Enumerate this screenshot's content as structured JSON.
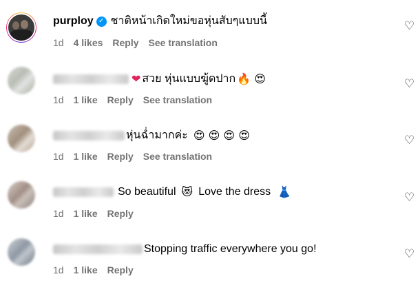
{
  "comments": [
    {
      "username": "purploy",
      "verified": true,
      "text": "ชาติหน้าเกิดใหม่ขอหุ่นสับๆแบบนี้",
      "time": "1d",
      "likes": "4 likes",
      "reply": "Reply",
      "translate": "See translation"
    },
    {
      "text": "สวย หุ่นแบบฆู้ดปาก",
      "emoji_before": "❤",
      "emoji_after": "🔥 😍",
      "time": "1d",
      "likes": "1 like",
      "reply": "Reply",
      "translate": "See translation"
    },
    {
      "text": "หุ่นฉ่ำมากค่ะ",
      "emoji_after": "😍 😍 😍 😍",
      "time": "1d",
      "likes": "1 like",
      "reply": "Reply",
      "translate": "See translation"
    },
    {
      "text": "So beautiful",
      "emoji_mid": "😻",
      "text2": "Love the dress",
      "emoji_after": "👗",
      "time": "1d",
      "likes": "1 like",
      "reply": "Reply"
    },
    {
      "text": "Stopping traffic everywhere you go!",
      "time": "1d",
      "likes": "1 like",
      "reply": "Reply"
    }
  ],
  "icons": {
    "like": "heart-outline-icon",
    "verified": "verified-badge-icon"
  },
  "colors": {
    "meta": "#737373",
    "verified": "#0095f6"
  }
}
